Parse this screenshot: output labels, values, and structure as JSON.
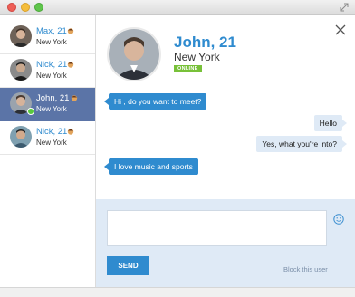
{
  "window": {
    "controls": [
      "close",
      "minimize",
      "zoom"
    ]
  },
  "sidebar": {
    "items": [
      {
        "name": "Max, 21",
        "city": "New York",
        "active": false,
        "online": false
      },
      {
        "name": "Nick, 21",
        "city": "New York",
        "active": false,
        "online": false
      },
      {
        "name": "John, 21",
        "city": "New York",
        "active": true,
        "online": true
      },
      {
        "name": "Nick, 21",
        "city": "New York",
        "active": false,
        "online": false
      }
    ]
  },
  "profile": {
    "name": "John, 21",
    "city": "New York",
    "status": "ONLINE"
  },
  "messages": [
    {
      "direction": "in",
      "text": "Hi , do you want to meet?"
    },
    {
      "direction": "out",
      "text": "Hello"
    },
    {
      "direction": "out",
      "text": "Yes, what you're into?"
    },
    {
      "direction": "in",
      "text": "I love music and sports"
    }
  ],
  "compose": {
    "value": "",
    "send_label": "SEND",
    "block_label": "Block this user"
  },
  "colors": {
    "accent": "#2f8bcf",
    "sidebar_active": "#5b74a7",
    "compose_bg": "#dfeaf6",
    "online": "#78c139"
  }
}
